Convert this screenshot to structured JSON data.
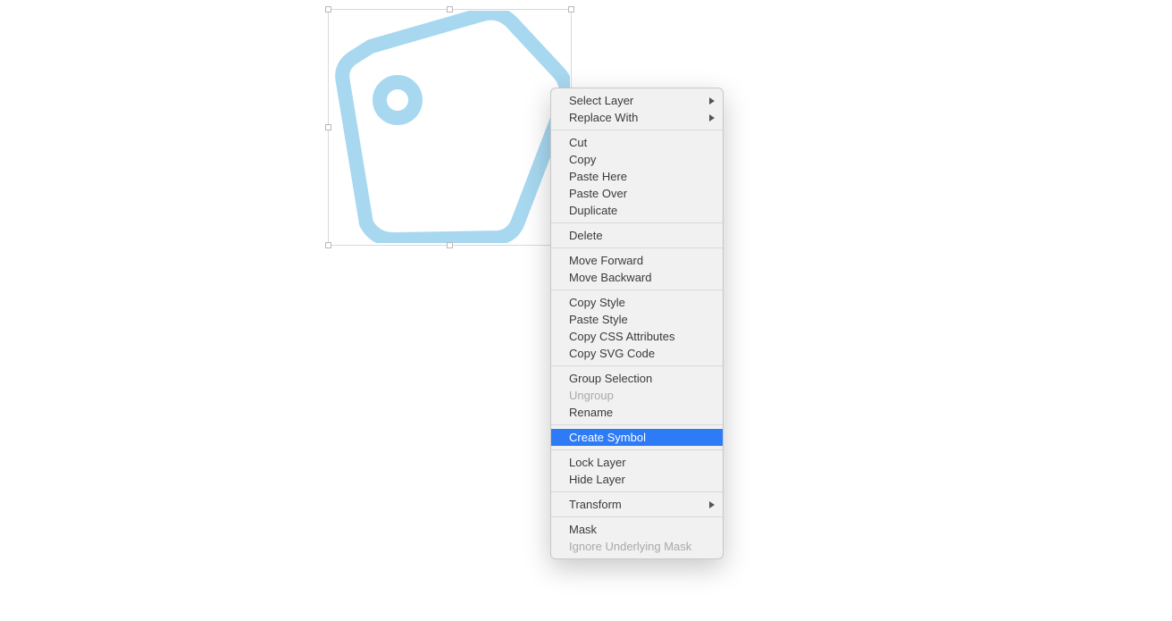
{
  "canvas": {
    "shape_name": "tag-icon",
    "stroke_color": "#a7d8f0"
  },
  "menu": {
    "groups": [
      [
        {
          "label": "Select Layer",
          "submenu": true
        },
        {
          "label": "Replace With",
          "submenu": true
        }
      ],
      [
        {
          "label": "Cut"
        },
        {
          "label": "Copy"
        },
        {
          "label": "Paste Here"
        },
        {
          "label": "Paste Over"
        },
        {
          "label": "Duplicate"
        }
      ],
      [
        {
          "label": "Delete"
        }
      ],
      [
        {
          "label": "Move Forward"
        },
        {
          "label": "Move Backward"
        }
      ],
      [
        {
          "label": "Copy Style"
        },
        {
          "label": "Paste Style"
        },
        {
          "label": "Copy CSS Attributes"
        },
        {
          "label": "Copy SVG Code"
        }
      ],
      [
        {
          "label": "Group Selection"
        },
        {
          "label": "Ungroup",
          "disabled": true
        },
        {
          "label": "Rename"
        }
      ],
      [
        {
          "label": "Create Symbol",
          "highlight": true
        }
      ],
      [
        {
          "label": "Lock Layer"
        },
        {
          "label": "Hide Layer"
        }
      ],
      [
        {
          "label": "Transform",
          "submenu": true
        }
      ],
      [
        {
          "label": "Mask"
        },
        {
          "label": "Ignore Underlying Mask",
          "disabled": true
        }
      ]
    ]
  }
}
